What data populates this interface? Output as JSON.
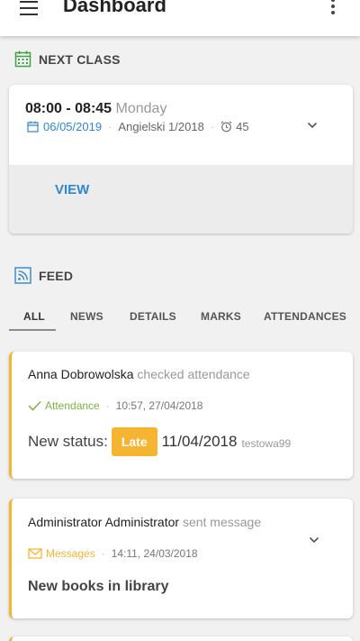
{
  "appbar": {
    "title": "Dashboard"
  },
  "next_class": {
    "header": "NEXT CLASS",
    "time": "08:00 - 08:45",
    "day": "Monday",
    "date": "06/05/2019",
    "course": "Angielski 1/2018",
    "duration": "45",
    "view_label": "VIEW"
  },
  "feed": {
    "header": "FEED",
    "tabs": [
      {
        "label": "ALL"
      },
      {
        "label": "NEWS"
      },
      {
        "label": "DETAILS"
      },
      {
        "label": "MARKS"
      },
      {
        "label": "ATTENDANCES"
      }
    ],
    "items": [
      {
        "author": "Anna Dobrowolska",
        "action": "checked attendance",
        "category": "Attendance",
        "timestamp": "10:57, 27/04/2018",
        "status_label": "New status:",
        "status_value": "Late",
        "status_date": "11/04/2018",
        "status_user": "testowa99"
      },
      {
        "author": "Administrator Administrator",
        "action": "sent message",
        "category": "Messages",
        "timestamp": "14:11, 24/03/2018",
        "subject": "New books in library"
      }
    ]
  },
  "colors": {
    "accent_blue": "#2f86d4",
    "attendance_green": "#7cb342",
    "late_orange": "#f6b531",
    "calendar_green": "#43a047"
  }
}
